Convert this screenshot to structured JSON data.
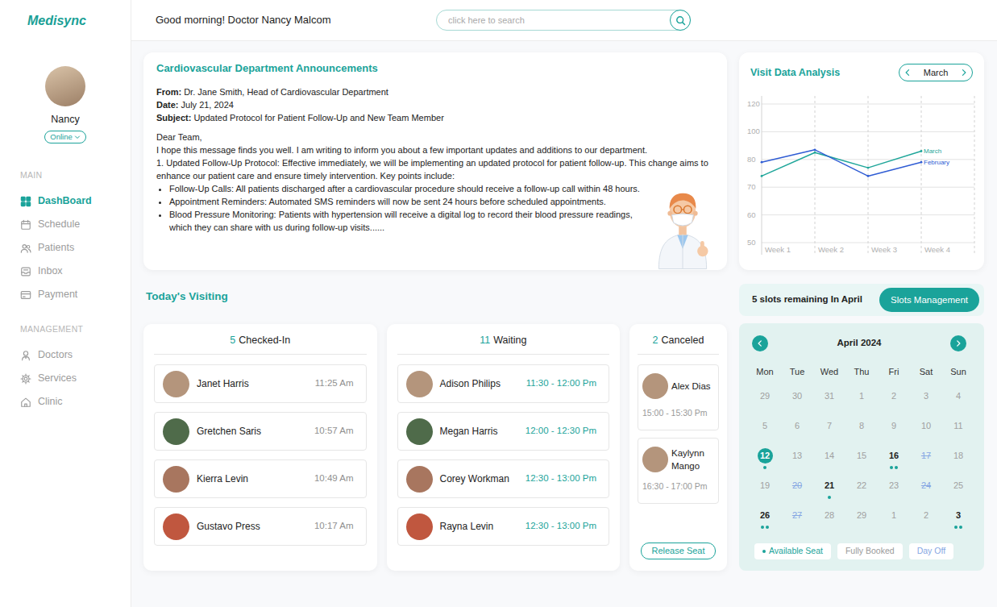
{
  "app": {
    "logo": "Medisync"
  },
  "header": {
    "greeting": "Good morning! Doctor Nancy Malcom",
    "search": {
      "placeholder": "click here to search"
    }
  },
  "profile": {
    "name": "Nancy",
    "status": "Online"
  },
  "sidebar": {
    "sections": [
      {
        "title": "MAIN",
        "items": [
          {
            "label": "DashBoard",
            "selected": true
          },
          {
            "label": "Schedule",
            "selected": false
          },
          {
            "label": "Patients",
            "selected": false
          },
          {
            "label": "Inbox",
            "selected": false
          },
          {
            "label": "Payment",
            "selected": false
          }
        ]
      },
      {
        "title": "MANAGEMENT",
        "items": [
          {
            "label": "Doctors",
            "selected": false
          },
          {
            "label": "Services",
            "selected": false
          },
          {
            "label": "Clinic",
            "selected": false
          }
        ]
      }
    ]
  },
  "announcement": {
    "title": "Cardiovascular Department Announcements",
    "meta": [
      {
        "label": "From:",
        "value": "Dr. Jane Smith, Head of Cardiovascular Department"
      },
      {
        "label": "Date:",
        "value": "July 21, 2024"
      },
      {
        "label": "Subject:",
        "value": "Updated Protocol for Patient Follow-Up and New Team Member"
      }
    ],
    "salutation": "Dear Team,",
    "paragraphs": [
      "I hope this message finds you well. I am writing to inform you about a few important updates and additions to our department.",
      "1. Updated Follow-Up Protocol: Effective immediately, we will be implementing an updated protocol for patient follow-up. This change aims to enhance our patient care and ensure timely intervention. Key points include:"
    ],
    "bullets": [
      "Follow-Up Calls: All patients discharged after a cardiovascular procedure should receive a follow-up call within 48 hours.",
      "Appointment Reminders: Automated SMS reminders will now be sent 24 hours before scheduled appointments.",
      "Blood Pressure Monitoring: Patients with hypertension will receive a digital log to record their blood pressure readings, which they can share with us during follow-up visits......"
    ]
  },
  "chart": {
    "title": "Visit Data Analysis",
    "month": "March",
    "y_ticks": [
      "120",
      "100",
      "80",
      "70",
      "60",
      "50"
    ],
    "x_ticks": [
      "Week 1",
      "Week 2",
      "Week 3",
      "Week 4"
    ],
    "series": [
      {
        "name": "March",
        "values": [
          74,
          85,
          77,
          86
        ],
        "color": "#1fa69a"
      },
      {
        "name": "February",
        "values": [
          79,
          87,
          74,
          79
        ],
        "color": "#2f5cd4"
      }
    ]
  },
  "visiting": {
    "title": "Today's Visiting",
    "groups": [
      {
        "count": "5",
        "label": "Checked-In",
        "kind": "checked-in",
        "patients": [
          {
            "name": "Janet Harris",
            "time": "11:25 Am"
          },
          {
            "name": "Gretchen Saris",
            "time": "10:57 Am"
          },
          {
            "name": "Kierra Levin",
            "time": "10:49 Am"
          },
          {
            "name": "Gustavo Press",
            "time": "10:17 Am"
          }
        ]
      },
      {
        "count": "11",
        "label": "Waiting",
        "kind": "waiting",
        "patients": [
          {
            "name": "Adison Philips",
            "time": "11:30 - 12:00 Pm"
          },
          {
            "name": "Megan Harris",
            "time": "12:00 - 12:30 Pm"
          },
          {
            "name": "Corey Workman",
            "time": "12:30 - 13:00 Pm"
          },
          {
            "name": "Rayna Levin",
            "time": "12:30 - 13:00 Pm"
          }
        ]
      },
      {
        "count": "2",
        "label": "Canceled",
        "kind": "canceled",
        "button": "Release Seat",
        "patients": [
          {
            "name": "Alex Dias",
            "time": "15:00 - 15:30 Pm"
          },
          {
            "name": "Kaylynn Mango",
            "time": "16:30 - 17:00 Pm"
          }
        ]
      }
    ]
  },
  "slots": {
    "text": "5 slots remaining In April",
    "button": "Slots Management"
  },
  "calendar": {
    "month": "April 2024",
    "weekdays": [
      "Mon",
      "Tue",
      "Wed",
      "Thu",
      "Fri",
      "Sat",
      "Sun"
    ],
    "weeks": [
      [
        {
          "label": "29",
          "kind": "booked",
          "dots": 0,
          "selected": false
        },
        {
          "label": "30",
          "kind": "booked",
          "dots": 0,
          "selected": false
        },
        {
          "label": "31",
          "kind": "booked",
          "dots": 0,
          "selected": false
        },
        {
          "label": "1",
          "kind": "booked",
          "dots": 0,
          "selected": false
        },
        {
          "label": "2",
          "kind": "booked",
          "dots": 0,
          "selected": false
        },
        {
          "label": "3",
          "kind": "booked",
          "dots": 0,
          "selected": false
        },
        {
          "label": "4",
          "kind": "booked",
          "dots": 0,
          "selected": false
        }
      ],
      [
        {
          "label": "5",
          "kind": "booked",
          "dots": 0,
          "selected": false
        },
        {
          "label": "6",
          "kind": "booked",
          "dots": 0,
          "selected": false
        },
        {
          "label": "7",
          "kind": "booked",
          "dots": 0,
          "selected": false
        },
        {
          "label": "8",
          "kind": "booked",
          "dots": 0,
          "selected": false
        },
        {
          "label": "9",
          "kind": "booked",
          "dots": 0,
          "selected": false
        },
        {
          "label": "10",
          "kind": "booked",
          "dots": 0,
          "selected": false
        },
        {
          "label": "11",
          "kind": "booked",
          "dots": 0,
          "selected": false
        }
      ],
      [
        {
          "label": "12",
          "kind": "available",
          "dots": 1,
          "selected": true
        },
        {
          "label": "13",
          "kind": "booked",
          "dots": 0,
          "selected": false
        },
        {
          "label": "14",
          "kind": "booked",
          "dots": 0,
          "selected": false
        },
        {
          "label": "15",
          "kind": "booked",
          "dots": 0,
          "selected": false
        },
        {
          "label": "16",
          "kind": "available",
          "dots": 2,
          "selected": false
        },
        {
          "label": "17",
          "kind": "off",
          "dots": 0,
          "selected": false
        },
        {
          "label": "18",
          "kind": "booked",
          "dots": 0,
          "selected": false
        }
      ],
      [
        {
          "label": "19",
          "kind": "booked",
          "dots": 0,
          "selected": false
        },
        {
          "label": "20",
          "kind": "off",
          "dots": 0,
          "selected": false
        },
        {
          "label": "21",
          "kind": "available",
          "dots": 1,
          "selected": false
        },
        {
          "label": "22",
          "kind": "booked",
          "dots": 0,
          "selected": false
        },
        {
          "label": "23",
          "kind": "booked",
          "dots": 0,
          "selected": false
        },
        {
          "label": "24",
          "kind": "off",
          "dots": 0,
          "selected": false
        },
        {
          "label": "25",
          "kind": "booked",
          "dots": 0,
          "selected": false
        }
      ],
      [
        {
          "label": "26",
          "kind": "available",
          "dots": 2,
          "selected": false
        },
        {
          "label": "27",
          "kind": "off",
          "dots": 0,
          "selected": false
        },
        {
          "label": "28",
          "kind": "booked",
          "dots": 0,
          "selected": false
        },
        {
          "label": "29",
          "kind": "booked",
          "dots": 0,
          "selected": false
        },
        {
          "label": "1",
          "kind": "booked",
          "dots": 0,
          "selected": false
        },
        {
          "label": "2",
          "kind": "booked",
          "dots": 0,
          "selected": false
        },
        {
          "label": "3",
          "kind": "available",
          "dots": 2,
          "selected": false
        }
      ]
    ],
    "legend": [
      {
        "label": "Available Seat",
        "kind": "available"
      },
      {
        "label": "Fully Booked",
        "kind": "booked"
      },
      {
        "label": "Day Off",
        "kind": "off"
      }
    ]
  }
}
